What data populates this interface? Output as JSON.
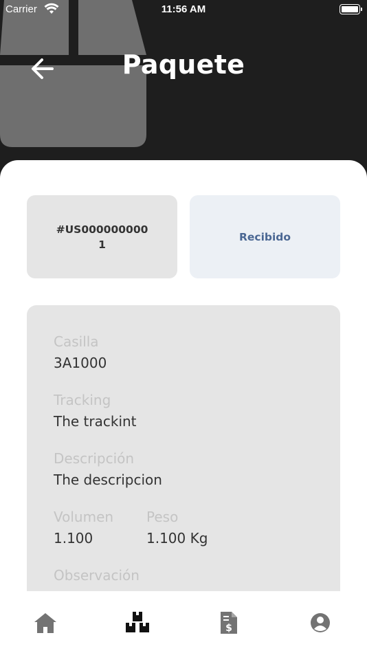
{
  "status_bar": {
    "carrier": "Carrier",
    "time": "11:56 AM",
    "battery_level": 1.0
  },
  "header": {
    "title": "Paquete",
    "back_icon": "arrow-left-icon",
    "background_icon": "package-box-icon"
  },
  "package": {
    "id": "#US0000000001",
    "status": "Recibido"
  },
  "details": {
    "casilla_label": "Casilla",
    "casilla_value": "3A1000",
    "tracking_label": "Tracking",
    "tracking_value": "The trackint",
    "descripcion_label": "Descripción",
    "descripcion_value": "The descripcion",
    "volumen_label": "Volumen",
    "volumen_value": "1.100",
    "peso_label": "Peso",
    "peso_value": "1.100 Kg",
    "observacion_label": "Observación"
  },
  "bottom_nav": {
    "items": [
      {
        "icon": "home-icon",
        "active": false
      },
      {
        "icon": "packages-icon",
        "active": true
      },
      {
        "icon": "invoice-icon",
        "active": false
      },
      {
        "icon": "profile-icon",
        "active": false
      }
    ]
  },
  "colors": {
    "header_bg": "#1e1e1e",
    "card_bg": "#e5e5e5",
    "status_bg": "#ecf0f5",
    "status_text": "#4a6793",
    "label_text": "#c4c4c4",
    "value_text": "#333333",
    "nav_icon": "#737373",
    "nav_icon_active": "#111111"
  }
}
